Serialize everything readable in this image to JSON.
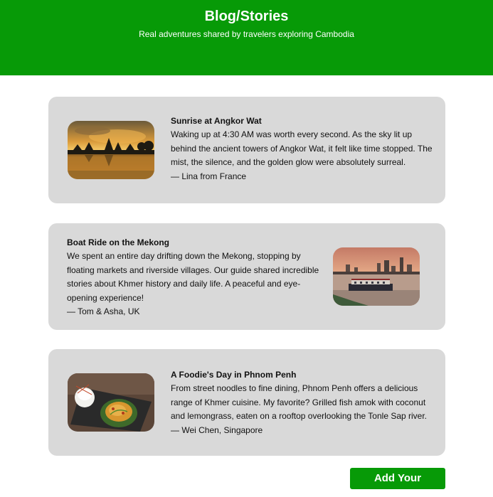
{
  "header": {
    "title": "Blog/Stories",
    "subtitle": "Real adventures shared by travelers exploring Cambodia"
  },
  "stories": [
    {
      "title": "Sunrise at Angkor Wat",
      "body": "Waking up at 4:30 AM was worth every second. As the sky lit up behind the ancient towers of Angkor Wat, it felt like time stopped. The mist, the silence, and the golden glow were absolutely surreal.",
      "author": "— Lina from France",
      "image": "angkor-wat-sunrise-photo"
    },
    {
      "title": "Boat Ride on the Mekong",
      "body": "We spent an entire day drifting down the Mekong, stopping by floating markets and riverside villages. Our guide shared incredible stories about Khmer history and daily life. A peaceful and eye-opening experience!",
      "author": "— Tom & Asha, UK",
      "image": "mekong-river-boat-photo"
    },
    {
      "title": "A Foodie's Day in Phnom Penh",
      "body": "From street noodles to fine dining, Phnom Penh offers a delicious range of Khmer cuisine. My favorite? Grilled fish amok with coconut and lemongrass, eaten on a rooftop overlooking the Tonle Sap river.",
      "author": "— Wei Chen, Singapore",
      "image": "fish-amok-dish-photo"
    }
  ],
  "actions": {
    "add_label": "Add Your"
  },
  "colors": {
    "brand_green": "#079a07",
    "card_background": "#d9d9d9"
  }
}
